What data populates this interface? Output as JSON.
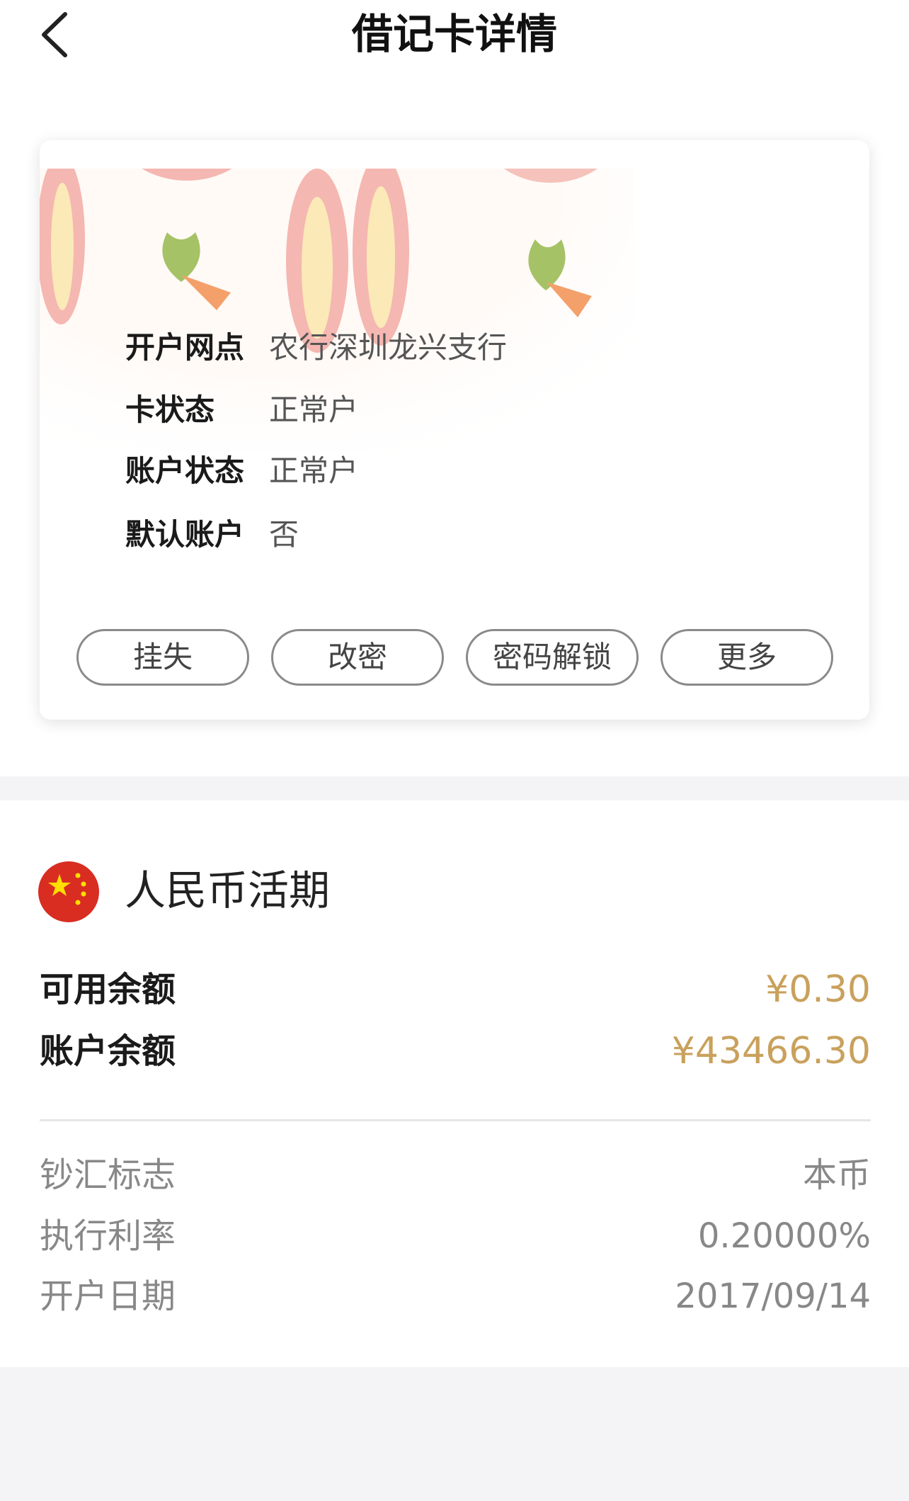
{
  "header": {
    "title": "借记卡详情"
  },
  "card_info": {
    "rows": [
      {
        "label": "开户网点",
        "value": "农行深圳龙兴支行"
      },
      {
        "label": "卡状态",
        "value": "正常户"
      },
      {
        "label": "账户状态",
        "value": "正常户"
      },
      {
        "label": "默认账户",
        "value": "否"
      }
    ],
    "buttons": [
      "挂失",
      "改密",
      "密码解锁",
      "更多"
    ]
  },
  "account": {
    "title": "人民币活期",
    "flag_icon": "china-flag-icon",
    "available_label": "可用余额",
    "available_value": "¥0.30",
    "balance_label": "账户余额",
    "balance_value": "¥43466.30",
    "details": [
      {
        "label": "钞汇标志",
        "value": "本币"
      },
      {
        "label": "执行利率",
        "value": "0.20000%"
      },
      {
        "label": "开户日期",
        "value": "2017/09/14"
      }
    ]
  },
  "colors": {
    "amount": "#c9a15c",
    "flag_red": "#d92d21",
    "flag_star": "#ffde00"
  }
}
